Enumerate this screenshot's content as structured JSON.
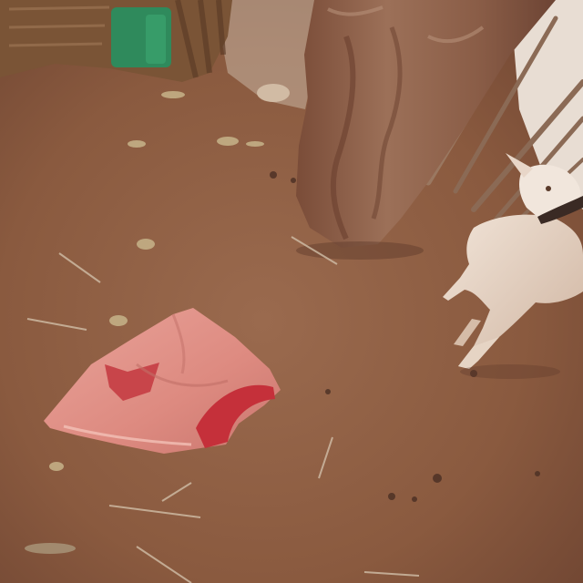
{
  "image": {
    "kind": "photograph",
    "subject": "goat-and-cloth-near-tree",
    "palette": {
      "soil": "#8d5d42",
      "soil_dark": "#6e4330",
      "soil_light": "#a7765a",
      "trunk": "#8a5a44",
      "trunk_light": "#a37a64",
      "cloth_pink": "#e08f86",
      "cloth_red": "#c5303a",
      "goat": "#e7d6c8",
      "goat_shadow": "#c9ad98",
      "can_green": "#2f8a5c",
      "hut_wall": "#7a5436",
      "sky_light": "#efe7de"
    }
  }
}
